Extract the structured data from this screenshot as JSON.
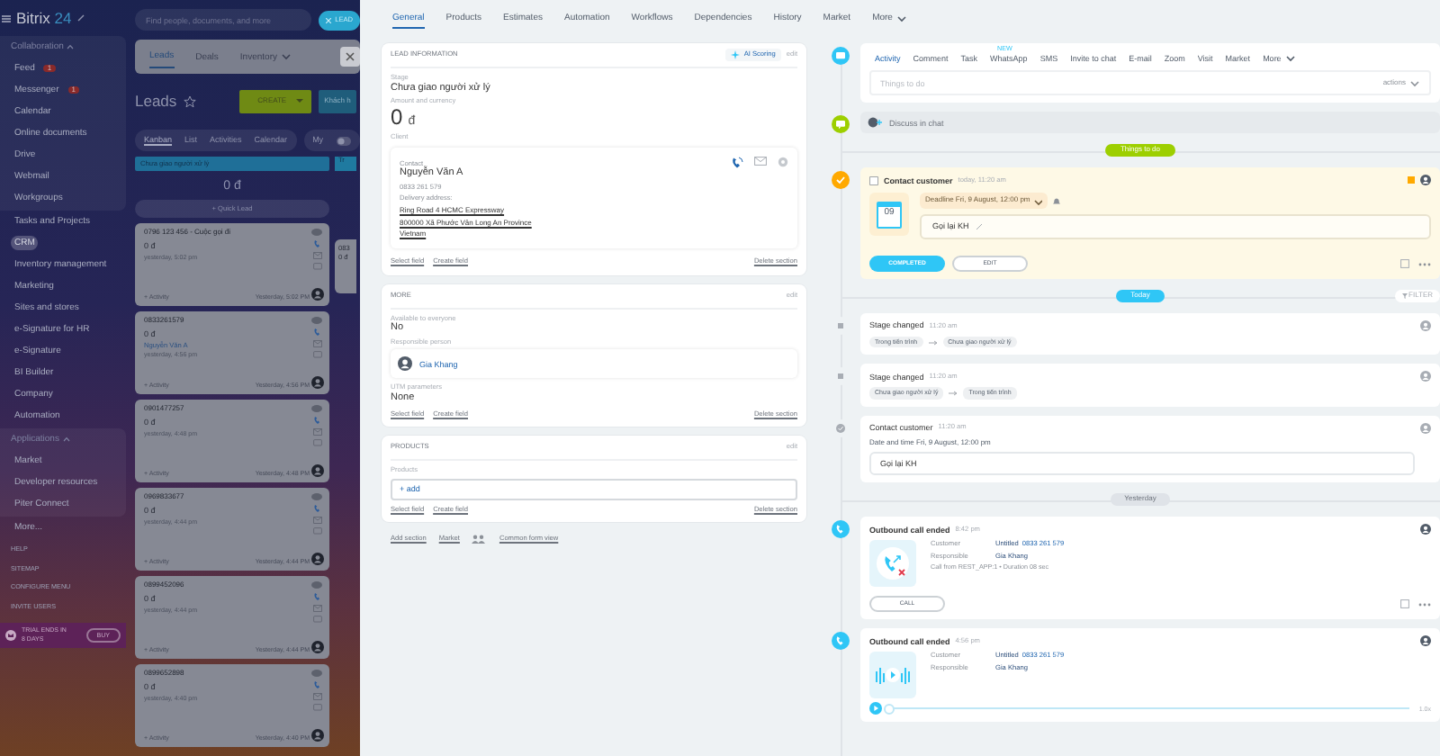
{
  "topbar": {
    "logo": "Bitrix",
    "logo_suffix": "24",
    "search_placeholder": "Find people, documents, and more",
    "lead_button": "LEAD"
  },
  "sidebar": {
    "groups": [
      {
        "title": "Collaboration",
        "expanded": true,
        "items": [
          {
            "label": "Feed",
            "badge": "1",
            "selected": false
          },
          {
            "label": "Messenger",
            "badge": "1",
            "selected": false
          },
          {
            "label": "Calendar",
            "selected": false
          },
          {
            "label": "Online documents",
            "selected": false
          },
          {
            "label": "Drive",
            "selected": false
          },
          {
            "label": "Webmail",
            "selected": false
          },
          {
            "label": "Workgroups",
            "selected": false
          }
        ]
      },
      {
        "items": [
          {
            "label": "Tasks and Projects",
            "selected": false
          },
          {
            "label": "CRM",
            "selected": true
          },
          {
            "label": "Inventory management",
            "selected": false
          },
          {
            "label": "Marketing",
            "selected": false
          },
          {
            "label": "Sites and stores",
            "selected": false
          },
          {
            "label": "e-Signature for HR",
            "selected": false
          },
          {
            "label": "e-Signature",
            "selected": false
          },
          {
            "label": "BI Builder",
            "selected": false
          },
          {
            "label": "Company",
            "selected": false
          },
          {
            "label": "Automation",
            "selected": false
          }
        ]
      },
      {
        "title": "Applications",
        "expanded": true,
        "items": [
          {
            "label": "Market",
            "selected": false
          },
          {
            "label": "Developer resources",
            "selected": false
          },
          {
            "label": "Piter Connect",
            "selected": false
          }
        ]
      },
      {
        "items": [
          {
            "label": "More...",
            "selected": false
          }
        ]
      }
    ],
    "footer_links": [
      "HELP",
      "SITEMAP",
      "CONFIGURE MENU",
      "INVITE USERS"
    ],
    "trial": {
      "text": "TRIAL ENDS IN 8 DAYS",
      "button": "BUY"
    }
  },
  "kanban": {
    "tabs": [
      {
        "label": "Leads",
        "selected": true
      },
      {
        "label": "Deals",
        "selected": false
      },
      {
        "label": "Inventory",
        "selected": false
      }
    ],
    "title": "Leads",
    "create_button": "CREATE",
    "stage_button": "Khách h",
    "views": [
      {
        "label": "Kanban",
        "selected": true
      },
      {
        "label": "List",
        "selected": false
      },
      {
        "label": "Activities",
        "selected": false
      },
      {
        "label": "Calendar",
        "selected": false
      }
    ],
    "my_filter": "My",
    "my_filter_on": false,
    "column": {
      "title": "Chưa giao người xử lý",
      "total": "0 đ",
      "quick_button": "+ Quick Lead"
    },
    "cards": [
      {
        "title": "0796 123 456 - Cuộc gọi đi",
        "amount": "0 đ",
        "date": "yesterday, 5:02 pm",
        "activity": "+ Activity",
        "footer": "Yesterday, 5:02 PM"
      },
      {
        "title": "0833261579",
        "amount": "0 đ",
        "contact": "Nguyễn Văn A",
        "date": "yesterday, 4:56 pm",
        "activity": "+ Activity",
        "footer": "Yesterday, 4:56 PM"
      },
      {
        "title": "0901477257",
        "amount": "0 đ",
        "date": "yesterday, 4:48 pm",
        "activity": "+ Activity",
        "footer": "Yesterday, 4:48 PM"
      },
      {
        "title": "0969833677",
        "amount": "0 đ",
        "date": "yesterday, 4:44 pm",
        "activity": "+ Activity",
        "footer": "Yesterday, 4:44 PM"
      },
      {
        "title": "0899452096",
        "amount": "0 đ",
        "date": "yesterday, 4:44 pm",
        "activity": "+ Activity",
        "footer": "Yesterday, 4:44 PM"
      },
      {
        "title": "0899652898",
        "amount": "0 đ",
        "date": "yesterday, 4:40 pm",
        "activity": "+ Activity",
        "footer": "Yesterday, 4:40 PM"
      }
    ],
    "next_column": {
      "title": "Tr",
      "card_lines": [
        "083",
        "0 đ"
      ]
    }
  },
  "lead": {
    "tabs": [
      {
        "label": "General",
        "selected": true
      },
      {
        "label": "Products",
        "selected": false
      },
      {
        "label": "Estimates",
        "selected": false
      },
      {
        "label": "Automation",
        "selected": false
      },
      {
        "label": "Workflows",
        "selected": false
      },
      {
        "label": "Dependencies",
        "selected": false
      },
      {
        "label": "History",
        "selected": false
      },
      {
        "label": "Market",
        "selected": false
      },
      {
        "label": "More",
        "selected": false
      }
    ],
    "sections": [
      {
        "title": "LEAD INFORMATION",
        "ai_button": "AI Scoring",
        "edit": "edit",
        "fields": [
          {
            "kind": "text",
            "label": "Stage",
            "value": "Chưa giao người xử lý"
          },
          {
            "kind": "amount",
            "label": "Amount and currency",
            "value": "0",
            "currency": "đ"
          },
          {
            "kind": "client",
            "label": "Client",
            "contact_label": "Contact",
            "name": "Nguyễn Văn A",
            "phone": "0833 261 579",
            "address_label": "Delivery address:",
            "address": [
              "Ring Road 4 HCMC Expressway",
              "800000 Xã Phước Vân Long An Province",
              "Vietnam"
            ]
          }
        ],
        "footer": {
          "select": "Select field",
          "create": "Create field",
          "delete": "Delete section"
        }
      },
      {
        "title": "MORE",
        "edit": "edit",
        "fields": [
          {
            "kind": "text",
            "label": "Available to everyone",
            "value": "No"
          },
          {
            "kind": "person",
            "label": "Responsible person",
            "name": "Gia Khang"
          },
          {
            "kind": "text",
            "label": "UTM parameters",
            "value": "None"
          }
        ],
        "footer": {
          "select": "Select field",
          "create": "Create field",
          "delete": "Delete section"
        }
      },
      {
        "title": "PRODUCTS",
        "edit": "edit",
        "fields": [
          {
            "kind": "add",
            "label": "Products",
            "value": "+ add"
          }
        ],
        "footer": {
          "select": "Select field",
          "create": "Create field",
          "delete": "Delete section"
        }
      }
    ],
    "bottom_links": [
      {
        "kind": "link",
        "label": "Add section"
      },
      {
        "kind": "link",
        "label": "Market"
      },
      {
        "kind": "icon-link",
        "label": "Common form view"
      }
    ]
  },
  "timeline": [
    {
      "kind": "editor",
      "tabs": [
        {
          "label": "Activity",
          "selected": true
        },
        {
          "label": "Comment",
          "selected": false
        },
        {
          "label": "Task",
          "selected": false
        },
        {
          "label": "WhatsApp",
          "selected": false,
          "badge": "NEW"
        },
        {
          "label": "SMS",
          "selected": false
        },
        {
          "label": "Invite to chat",
          "selected": false
        },
        {
          "label": "E-mail",
          "selected": false
        },
        {
          "label": "Zoom",
          "selected": false
        },
        {
          "label": "Visit",
          "selected": false
        },
        {
          "label": "Market",
          "selected": false
        },
        {
          "label": "More",
          "selected": false
        }
      ],
      "placeholder": "Things to do",
      "actions": "actions"
    },
    {
      "kind": "chat",
      "label": "Discuss in chat"
    },
    {
      "kind": "divider",
      "label": "Things to do",
      "color": "#9dcf00"
    },
    {
      "kind": "todo",
      "checked": false,
      "title": "Contact customer",
      "time": "today, 11:20 am",
      "day": "09",
      "deadline": "Deadline Fri, 9 August, 12:00 pm",
      "note": "Gọi lại KH",
      "complete_button": "COMPLETED",
      "edit_button": "EDIT"
    },
    {
      "kind": "divider",
      "label": "Today",
      "color": "#2fc6f6",
      "filter": "FILTER"
    },
    {
      "kind": "stage",
      "title": "Stage changed",
      "time": "11:20 am",
      "from": "Trong tiến trình",
      "to": "Chưa giao người xử lý"
    },
    {
      "kind": "stage",
      "title": "Stage changed",
      "time": "11:20 am",
      "from": "Chưa giao người xử lý",
      "to": "Trong tiến trình"
    },
    {
      "kind": "done",
      "title": "Contact customer",
      "time": "11:20 am",
      "detail": "Date and time Fri, 9 August, 12:00 pm",
      "note": "Gọi lại KH"
    },
    {
      "kind": "divider",
      "label": "Yesterday",
      "color": "#dfe3e8"
    },
    {
      "kind": "call",
      "title": "Outbound call ended",
      "time": "8:42 pm",
      "rows": [
        {
          "label": "Customer",
          "value": "Untitled",
          "link": "0833 261 579"
        },
        {
          "label": "Responsible",
          "value": "Gia Khang"
        }
      ],
      "info": "Call from REST_APP:1 • Duration 08 sec",
      "button": "CALL"
    },
    {
      "kind": "audio",
      "title": "Outbound call ended",
      "time": "4:56 pm",
      "rows": [
        {
          "label": "Customer",
          "value": "Untitled",
          "link": "0833 261 579"
        },
        {
          "label": "Responsible",
          "value": "Gia Khang"
        }
      ],
      "level": 0,
      "speed": "1.0x"
    }
  ]
}
